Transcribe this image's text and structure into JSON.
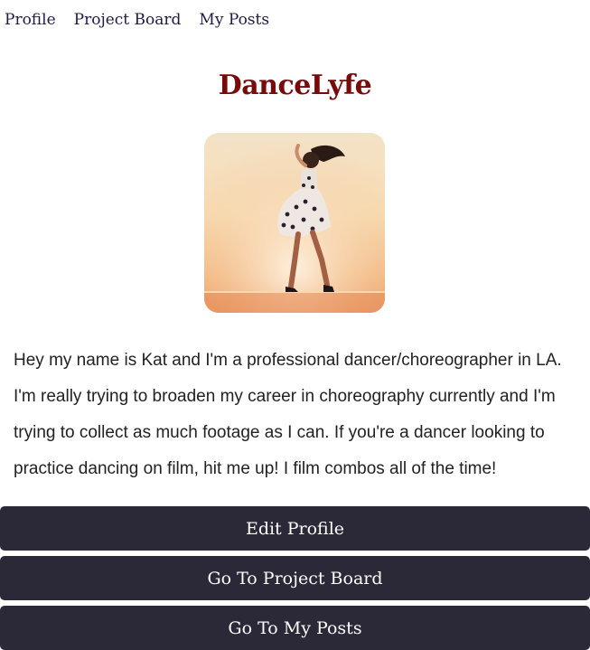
{
  "nav": {
    "profile": "Profile",
    "project_board": "Project Board",
    "my_posts": "My Posts"
  },
  "header": {
    "title": "DanceLyfe"
  },
  "profile": {
    "photo_icon": "dancer-photo",
    "bio": "Hey my name is Kat and I'm a professional dancer/choreographer in LA. I'm really trying to broaden my career in choreography currently and I'm trying to collect as much footage as I can. If you're a dancer looking to practice dancing on film, hit me up! I film combos all of the time!"
  },
  "actions": {
    "edit_profile": "Edit Profile",
    "go_project_board": "Go To Project Board",
    "go_my_posts": "Go To My Posts"
  },
  "colors": {
    "title": "#7a0a0a",
    "nav_link": "#1f1a4a",
    "button_bg": "#2b2938",
    "button_text": "#ffffff"
  }
}
